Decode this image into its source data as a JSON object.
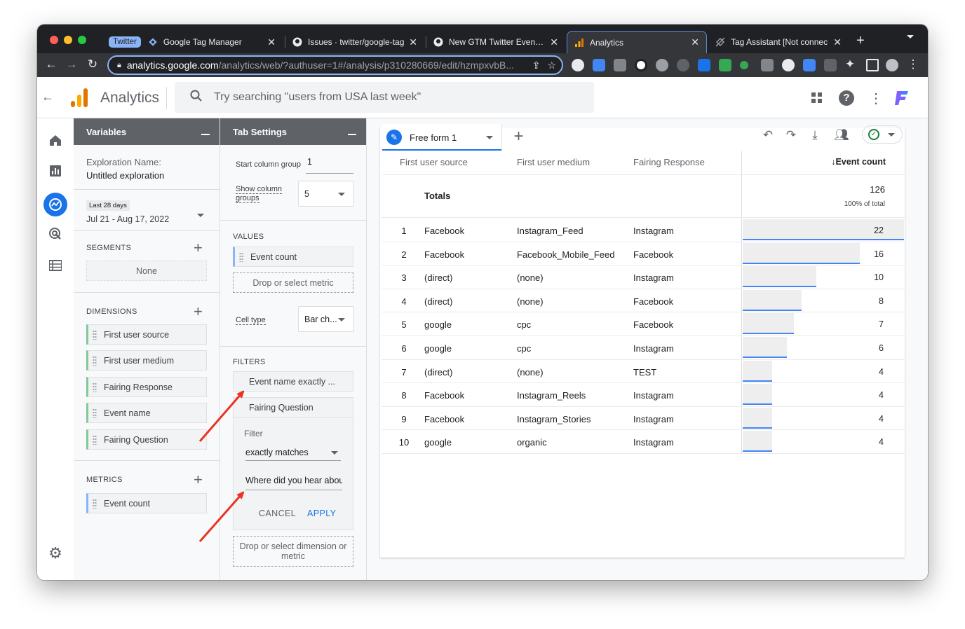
{
  "browser": {
    "tabs": [
      {
        "label": "Google Tag Manager",
        "badge": "Twitter"
      },
      {
        "label": "Issues · twitter/google-tag"
      },
      {
        "label": "New GTM Twitter Event Pi"
      },
      {
        "label": "Analytics"
      },
      {
        "label": "Tag Assistant [Not connec"
      }
    ],
    "url_host": "analytics.google.com",
    "url_path": "/analytics/web/?authuser=1#/analysis/p310280669/edit/hzmpxvbB..."
  },
  "ga": {
    "app_name": "Analytics",
    "search_placeholder": "Try searching \"users from USA last week\""
  },
  "variables": {
    "title": "Variables",
    "exploration_label": "Exploration Name:",
    "exploration_name": "Untitled exploration",
    "date_label": "Last 28 days",
    "date_range": "Jul 21 - Aug 17, 2022",
    "segments_label": "SEGMENTS",
    "segments_none": "None",
    "dimensions_label": "DIMENSIONS",
    "dimensions": [
      "First user source",
      "First user medium",
      "Fairing Response",
      "Event name",
      "Fairing Question"
    ],
    "metrics_label": "METRICS",
    "metrics": [
      "Event count"
    ]
  },
  "tab_settings": {
    "title": "Tab Settings",
    "start_group_label": "Start column group",
    "start_group_value": "1",
    "show_groups_label_1": "Show column",
    "show_groups_label_2": "groups",
    "show_groups_value": "5",
    "values_label": "VALUES",
    "value_chip": "Event count",
    "drop_metric": "Drop or select metric",
    "cell_type_label": "Cell type",
    "cell_type_value": "Bar ch...",
    "filters_label": "FILTERS",
    "filter_chip": "Event name exactly ...",
    "filter_question": "Fairing Question",
    "filter_label": "Filter",
    "match_type": "exactly matches",
    "match_value": "Where did you hear abou",
    "cancel": "CANCEL",
    "apply": "APPLY",
    "drop_dimension": "Drop or select dimension or metric"
  },
  "report": {
    "tab_name": "Free form 1",
    "columns": [
      "First user source",
      "First user medium",
      "Fairing Response",
      "↓Event count"
    ],
    "totals_label": "Totals",
    "totals_value": "126",
    "totals_pct": "100% of total",
    "max_value": 22,
    "rows": [
      {
        "n": "1",
        "source": "Facebook",
        "medium": "Instagram_Feed",
        "response": "Instagram",
        "count": "22",
        "value": 22
      },
      {
        "n": "2",
        "source": "Facebook",
        "medium": "Facebook_Mobile_Feed",
        "response": "Facebook",
        "count": "16",
        "value": 16
      },
      {
        "n": "3",
        "source": "(direct)",
        "medium": "(none)",
        "response": "Instagram",
        "count": "10",
        "value": 10
      },
      {
        "n": "4",
        "source": "(direct)",
        "medium": "(none)",
        "response": "Facebook",
        "count": "8",
        "value": 8
      },
      {
        "n": "5",
        "source": "google",
        "medium": "cpc",
        "response": "Facebook",
        "count": "7",
        "value": 7
      },
      {
        "n": "6",
        "source": "google",
        "medium": "cpc",
        "response": "Instagram",
        "count": "6",
        "value": 6
      },
      {
        "n": "7",
        "source": "(direct)",
        "medium": "(none)",
        "response": "TEST",
        "count": "4",
        "value": 4
      },
      {
        "n": "8",
        "source": "Facebook",
        "medium": "Instagram_Reels",
        "response": "Instagram",
        "count": "4",
        "value": 4
      },
      {
        "n": "9",
        "source": "Facebook",
        "medium": "Instagram_Stories",
        "response": "Instagram",
        "count": "4",
        "value": 4
      },
      {
        "n": "10",
        "source": "google",
        "medium": "organic",
        "response": "Instagram",
        "count": "4",
        "value": 4
      }
    ]
  },
  "colors": {
    "accent": "#1a73e8",
    "bar": "#4285f4",
    "annotation": "#ea3323"
  }
}
